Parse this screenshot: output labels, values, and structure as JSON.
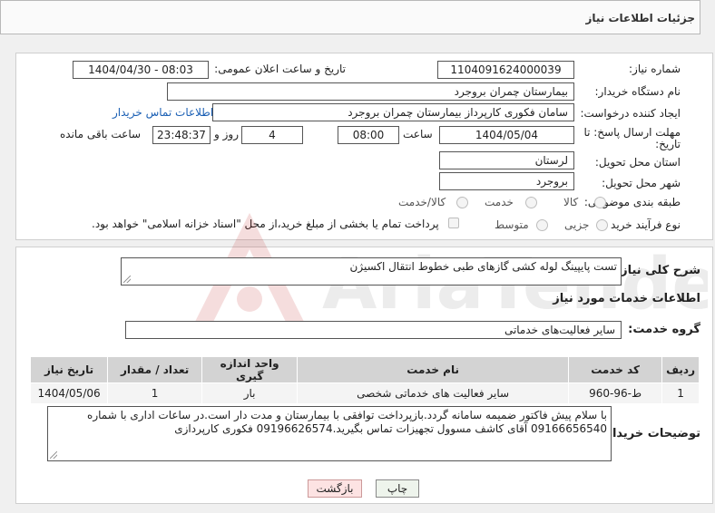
{
  "header": {
    "title": "جزئیات اطلاعات نیاز"
  },
  "fields": {
    "need_number_label": "شماره نیاز:",
    "need_number": "1104091624000039",
    "announce_label": "تاریخ و ساعت اعلان عمومی:",
    "announce_value": "1404/04/30 - 08:03",
    "buyer_org_label": "نام دستگاه خریدار:",
    "buyer_org": "بیمارستان چمران بروجرد",
    "creator_label": "ایجاد کننده درخواست:",
    "creator": "سامان فکوری کارپرداز بیمارستان چمران بروجرد",
    "contact_link": "اطلاعات تماس خریدار",
    "deadline_label_1": "مهلت ارسال پاسخ: تا",
    "deadline_label_2": "تاریخ:",
    "deadline_date": "1404/05/04",
    "time_label": "ساعت",
    "deadline_time": "08:00",
    "days_value": "4",
    "days_label": "روز و",
    "remaining_time": "23:48:37",
    "remaining_label": "ساعت باقی مانده",
    "province_label": "استان محل تحویل:",
    "province": "لرستان",
    "city_label": "شهر محل تحویل:",
    "city": "بروجرد",
    "category_label": "طبقه بندی موضوعی:",
    "category_options": [
      "کالا",
      "خدمت",
      "کالا/خدمت"
    ],
    "process_label": "نوع فرآیند خرید :",
    "process_options": [
      "جزیی",
      "متوسط"
    ],
    "payment_note": "پرداخت تمام یا بخشی از مبلغ خرید،از محل \"اسناد خزانه اسلامی\" خواهد بود."
  },
  "description": {
    "label": "شرح کلی نیاز:",
    "value": "تست پایپینگ لوله کشی گازهای طبی خطوط انتقال اکسیژن"
  },
  "services": {
    "section_title": "اطلاعات خدمات مورد نیاز",
    "group_label": "گروه خدمت:",
    "group_value": "سایر فعالیت‌های خدماتی",
    "columns": [
      "ردیف",
      "کد خدمت",
      "نام خدمت",
      "واحد اندازه گیری",
      "تعداد / مقدار",
      "تاریخ نیاز"
    ],
    "rows": [
      [
        "1",
        "ط-96-960",
        "سایر فعالیت های خدماتی شخصی",
        "بار",
        "1",
        "1404/05/06"
      ]
    ]
  },
  "buyer_notes": {
    "label": "توضیحات خریدار:",
    "line1": "با سلام پیش فاکتور ضمیمه سامانه گردد.بازپرداخت توافقی با بیمارستان و مدت دار است.در ساعات اداری با شماره",
    "line2": "09166656540 آقای کاشف مسوول تجهیزات تماس بگیرید.09196626574 فکوری کارپردازی"
  },
  "buttons": {
    "print": "چاپ",
    "back": "بازگشت"
  },
  "colors": {
    "accent_link": "#1a5fb4",
    "back_button_bg": "#fde3e3",
    "print_button_bg": "#eef4ec"
  }
}
